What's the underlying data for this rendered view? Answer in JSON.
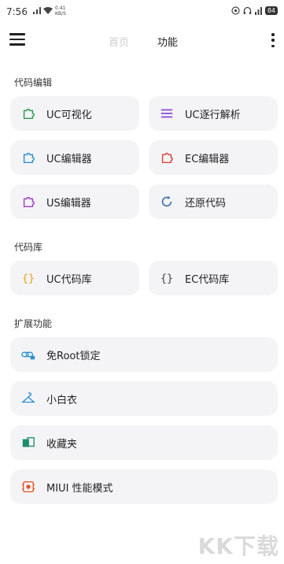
{
  "status_bar": {
    "time": "7:56",
    "speed_value": "0.41",
    "speed_unit": "KB/S",
    "battery": "84"
  },
  "header": {
    "tab_home": "首页",
    "tab_functions": "功能"
  },
  "sections": [
    {
      "title": "代码编辑",
      "items": [
        {
          "label": "UC可视化",
          "icon": "puzzle-icon",
          "color": "#2e9e4f"
        },
        {
          "label": "UC逐行解析",
          "icon": "list-icon",
          "color": "#8a4fd6"
        },
        {
          "label": "UC编辑器",
          "icon": "puzzle-icon",
          "color": "#2f8fd6"
        },
        {
          "label": "EC编辑器",
          "icon": "puzzle-icon",
          "color": "#d64a3a"
        },
        {
          "label": "US编辑器",
          "icon": "puzzle-icon",
          "color": "#a13fc7"
        },
        {
          "label": "还原代码",
          "icon": "restore-icon",
          "color": "#3a6fb0"
        }
      ]
    },
    {
      "title": "代码库",
      "items": [
        {
          "label": "UC代码库",
          "icon": "braces-icon",
          "color": "#e0a21b"
        },
        {
          "label": "EC代码库",
          "icon": "braces-icon",
          "color": "#444444"
        }
      ]
    },
    {
      "title": "扩展功能",
      "items": [
        {
          "label": "免Root锁定",
          "icon": "link-lock-icon",
          "color": "#2f8fd6"
        },
        {
          "label": "小白衣",
          "icon": "hanger-icon",
          "color": "#2f8fd6"
        },
        {
          "label": "收藏夹",
          "icon": "folder-icon",
          "color": "#1c8f6a"
        },
        {
          "label": "MIUI 性能模式",
          "icon": "chip-icon",
          "color": "#e2582c"
        }
      ]
    }
  ],
  "watermark": "KK下载"
}
